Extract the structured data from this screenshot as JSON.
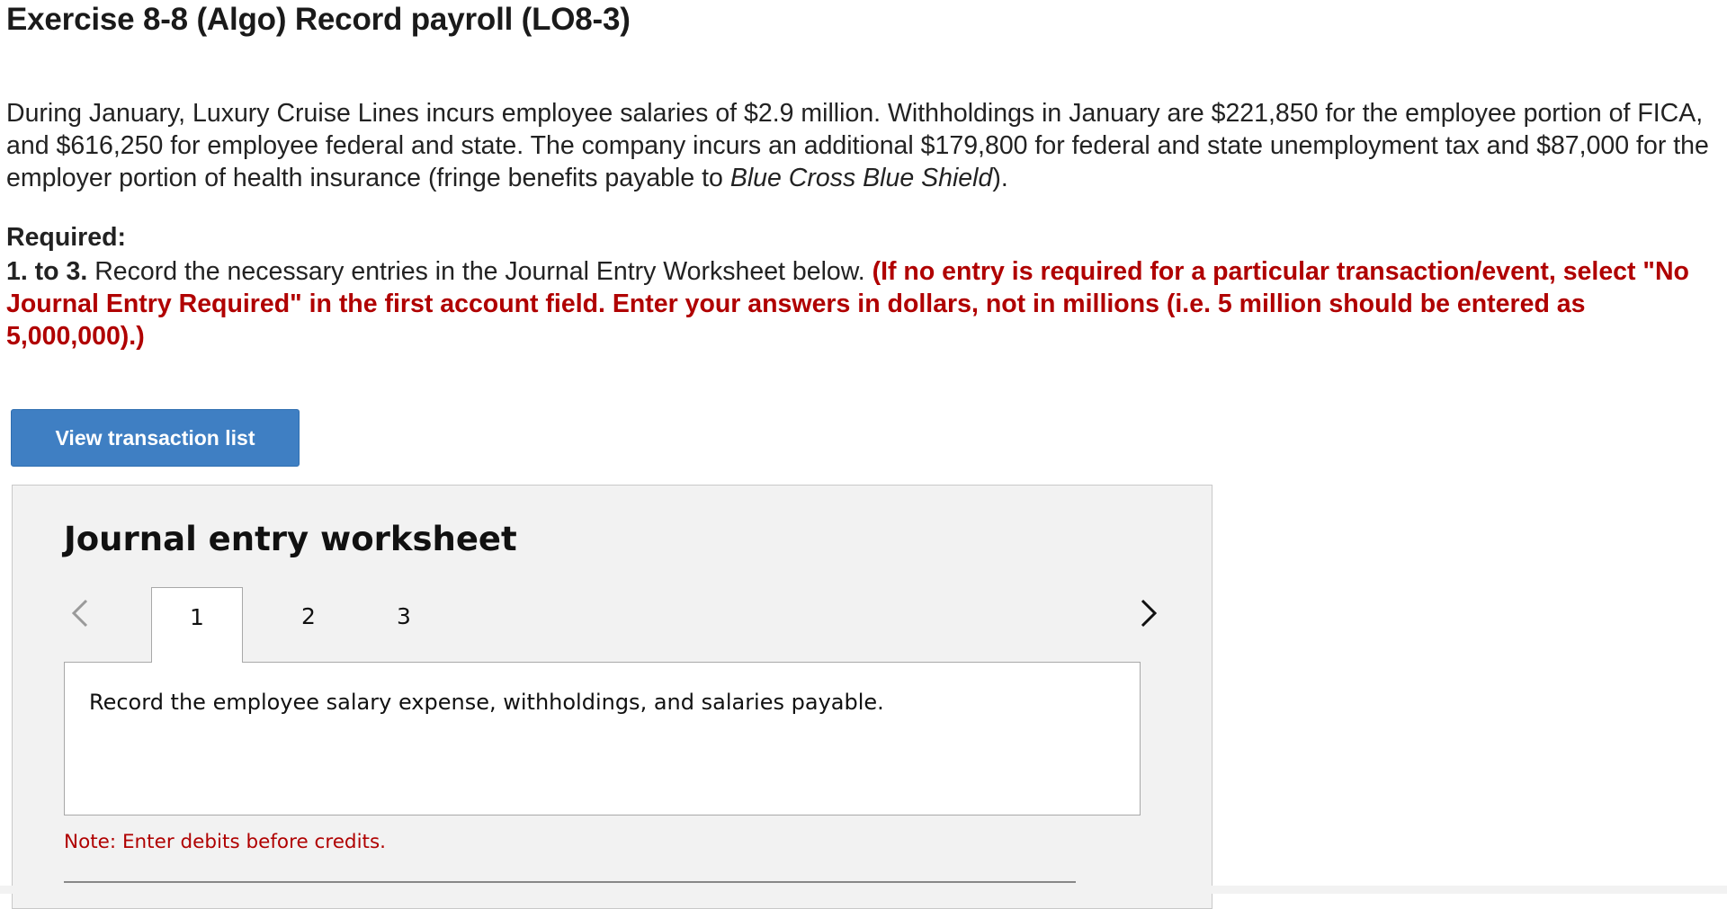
{
  "exercise": {
    "title": "Exercise 8-8 (Algo) Record payroll (LO8-3)"
  },
  "intro": {
    "text_before_italic": "During January, Luxury Cruise Lines incurs employee salaries of $2.9 million. Withholdings in January are $221,850 for the employee portion of FICA, and $616,250 for employee federal and state. The company incurs an additional $179,800 for federal and state unemployment tax and $87,000 for the employer portion of health insurance (fringe benefits payable to ",
    "italic_text": "Blue Cross Blue Shield",
    "text_after_italic": ")."
  },
  "required": {
    "heading": "Required:",
    "number_label": "1. to 3.",
    "instruction": " Record the necessary entries in the Journal Entry Worksheet below. ",
    "red_instruction": "(If no entry is required for a particular transaction/event, select \"No Journal Entry Required\" in the first account field. Enter your answers in dollars, not in millions (i.e. 5 million should be entered as 5,000,000).)"
  },
  "buttons": {
    "view_transaction_list": "View transaction list"
  },
  "worksheet": {
    "title": "Journal entry worksheet",
    "tabs": [
      {
        "label": "1",
        "active": true
      },
      {
        "label": "2",
        "active": false
      },
      {
        "label": "3",
        "active": false
      }
    ],
    "panel_text": "Record the employee salary expense, withholdings, and salaries payable.",
    "note": "Note: Enter debits before credits.",
    "icons": {
      "prev": "chevron-left-icon",
      "next": "chevron-right-icon"
    }
  },
  "colors": {
    "accent_blue": "#3f7fc3",
    "warning_red": "#b00000",
    "panel_gray": "#f2f2f2"
  }
}
